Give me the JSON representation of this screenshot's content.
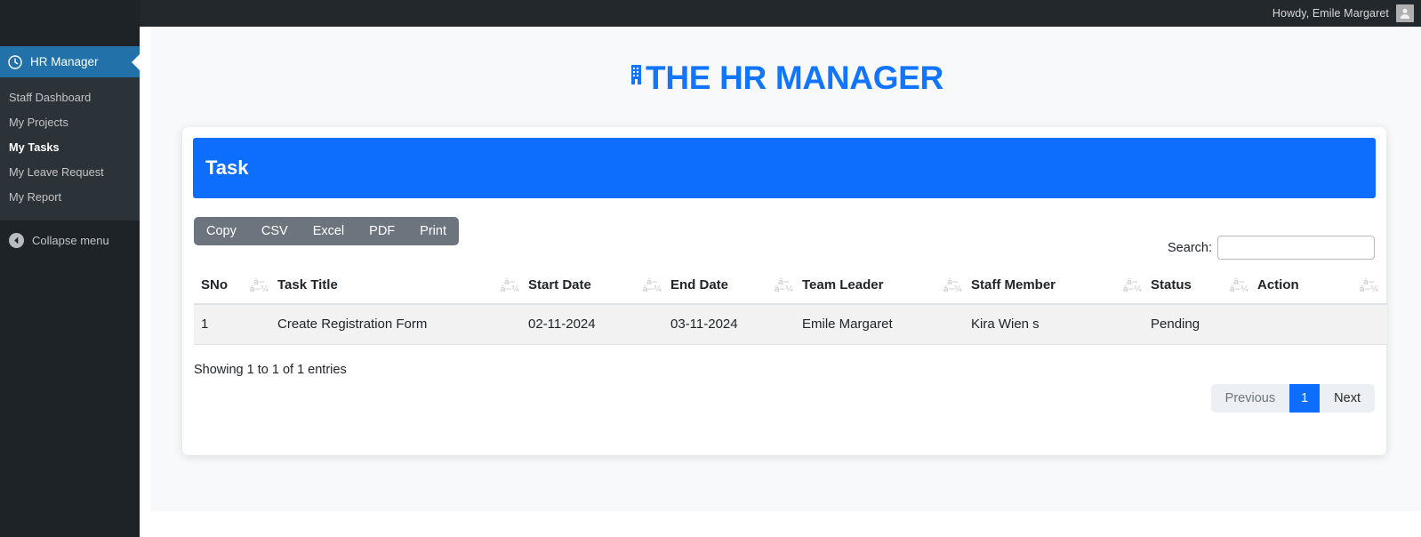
{
  "topbar": {
    "howdy": "Howdy, Emile Margaret",
    "avatar_icon": "user-avatar-icon"
  },
  "sidebar": {
    "brand": {
      "label": "HR Manager",
      "icon": "clock-icon"
    },
    "items": [
      {
        "label": "Staff Dashboard",
        "active": false
      },
      {
        "label": "My Projects",
        "active": false
      },
      {
        "label": "My Tasks",
        "active": true
      },
      {
        "label": "My Leave Request",
        "active": false
      },
      {
        "label": "My Report",
        "active": false
      }
    ],
    "collapse": {
      "label": "Collapse menu",
      "icon": "chevron-left-circle-icon"
    }
  },
  "header": {
    "title": "THE HR MANAGER",
    "icon": "building-icon",
    "color": "#1275ff"
  },
  "card": {
    "title": "Task",
    "header_color": "#0d6efd",
    "export_buttons": [
      "Copy",
      "CSV",
      "Excel",
      "PDF",
      "Print"
    ],
    "search": {
      "label": "Search:",
      "value": "",
      "placeholder": ""
    },
    "table": {
      "columns": [
        "SNo",
        "Task Title",
        "Start Date",
        "End Date",
        "Team Leader",
        "Staff Member",
        "Status",
        "Action"
      ],
      "sort_glyph_top": "â−",
      "sort_glyph_bottom": "â−¼",
      "rows": [
        {
          "sno": "1",
          "task_title": "Create Registration Form",
          "start_date": "02-11-2024",
          "end_date": "03-11-2024",
          "team_leader": "Emile Margaret",
          "staff_member": "Kira Wien s",
          "status": "Pending",
          "action": ""
        }
      ]
    },
    "showing": "Showing 1 to 1 of 1 entries",
    "pagination": {
      "previous": "Previous",
      "pages": [
        "1"
      ],
      "next": "Next",
      "active_page": "1"
    }
  }
}
